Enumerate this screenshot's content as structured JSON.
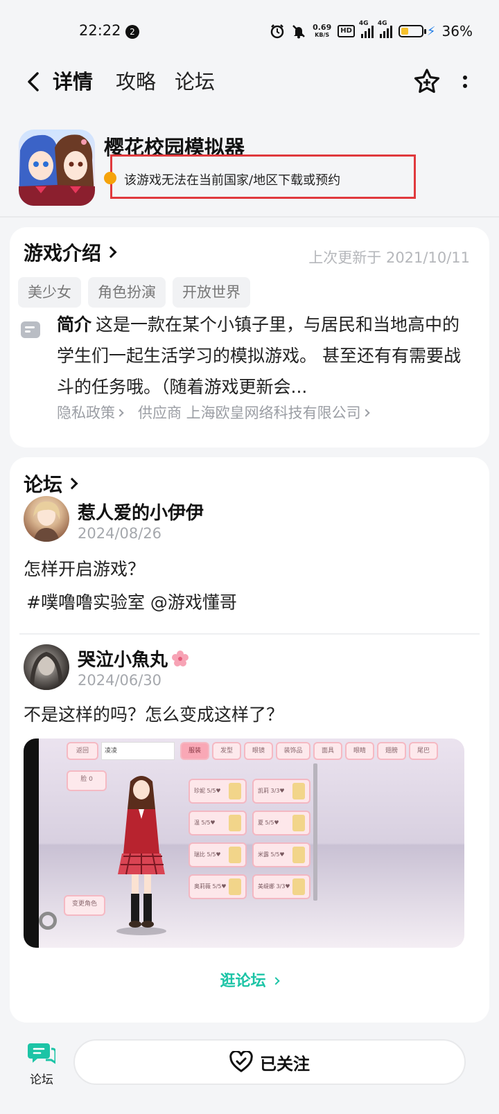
{
  "status_bar": {
    "time": "22:22",
    "notification_count": "2",
    "net_speed": "0.69",
    "net_unit": "KB/S",
    "hd_label": "HD",
    "sig1_tag": "4G",
    "sig2_tag": "4G",
    "battery": "36%",
    "battery_level": 0.36
  },
  "nav": {
    "tabs": [
      {
        "label": "详情"
      },
      {
        "label": "攻略"
      },
      {
        "label": "论坛"
      }
    ]
  },
  "game": {
    "title": "樱花校园模拟器",
    "notice": "该游戏无法在当前国家/地区下载或预约"
  },
  "intro": {
    "title": "游戏介绍",
    "updated": "上次更新于 2021/10/11",
    "tags": [
      "美少女",
      "角色扮演",
      "开放世界"
    ],
    "label": "简介",
    "description": "这是一款在某个小镇子里，与居民和当地高中的学生们一起生活学习的模拟游戏。 甚至还有有需要战斗的任务哦。（随着游戏更新会...",
    "privacy": "隐私政策",
    "supplier": "供应商 上海欧皇网络科技有限公司"
  },
  "forum": {
    "title": "论坛",
    "posts": [
      {
        "user": "惹人爱的小伊伊",
        "date": "2024/08/26",
        "text": "怎样开启游戏？",
        "topics": "#噗噜噜实验室 @游戏懂哥"
      },
      {
        "user": "哭泣小魚丸",
        "date": "2024/06/30",
        "text": "不是这样的吗？怎么变成这样了？"
      }
    ],
    "screenshot": {
      "back": "返回",
      "name_value": "凌凌",
      "tabs": [
        "服装",
        "发型",
        "眼镜",
        "装饰品",
        "面具",
        "眼睛",
        "翅膀",
        "尾巴"
      ],
      "face": "脸  0",
      "change_role": "变更角色",
      "items": [
        {
          "name": "珍妮",
          "count": "5/5♥"
        },
        {
          "name": "凯莉",
          "count": "3/3♥"
        },
        {
          "name": "温",
          "count": "5/5♥"
        },
        {
          "name": "夏",
          "count": "5/5♥"
        },
        {
          "name": "瑞比",
          "count": "5/5♥"
        },
        {
          "name": "米露",
          "count": "5/5♥"
        },
        {
          "name": "奥莉薇",
          "count": "5/5♥"
        },
        {
          "name": "美缇娜",
          "count": "3/3♥"
        }
      ]
    },
    "more_link": "逛论坛"
  },
  "bottom": {
    "forum_label": "论坛",
    "follow_label": "已关注"
  },
  "colors": {
    "accent": "#1cc4a6",
    "tab_underline": "#2dd4b5",
    "warning_border": "#e0393d",
    "warning_dot": "#f5a30b"
  }
}
